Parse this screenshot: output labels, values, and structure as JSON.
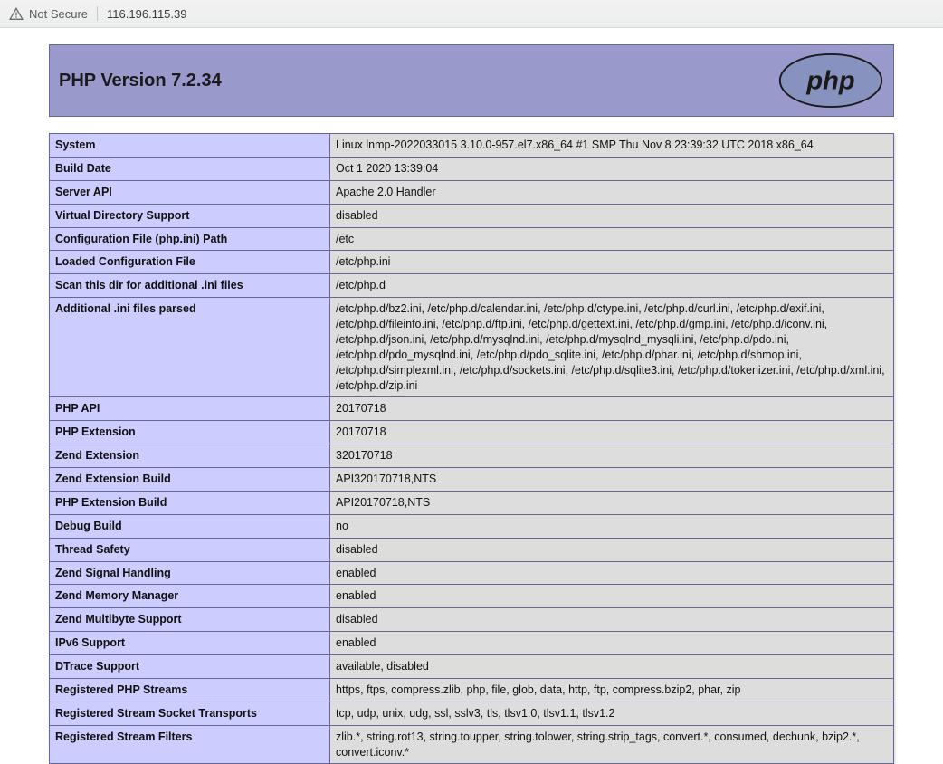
{
  "browser": {
    "security_label": "Not Secure",
    "address": "116.196.115.39"
  },
  "header": {
    "title": "PHP Version 7.2.34",
    "logo_text": "php"
  },
  "rows": [
    {
      "k": "System",
      "v": "Linux lnmp-2022033015 3.10.0-957.el7.x86_64 #1 SMP Thu Nov 8 23:39:32 UTC 2018 x86_64"
    },
    {
      "k": "Build Date",
      "v": "Oct 1 2020 13:39:04"
    },
    {
      "k": "Server API",
      "v": "Apache 2.0 Handler"
    },
    {
      "k": "Virtual Directory Support",
      "v": "disabled"
    },
    {
      "k": "Configuration File (php.ini) Path",
      "v": "/etc"
    },
    {
      "k": "Loaded Configuration File",
      "v": "/etc/php.ini"
    },
    {
      "k": "Scan this dir for additional .ini files",
      "v": "/etc/php.d"
    },
    {
      "k": "Additional .ini files parsed",
      "v": "/etc/php.d/bz2.ini, /etc/php.d/calendar.ini, /etc/php.d/ctype.ini, /etc/php.d/curl.ini, /etc/php.d/exif.ini, /etc/php.d/fileinfo.ini, /etc/php.d/ftp.ini, /etc/php.d/gettext.ini, /etc/php.d/gmp.ini, /etc/php.d/iconv.ini, /etc/php.d/json.ini, /etc/php.d/mysqlnd.ini, /etc/php.d/mysqlnd_mysqli.ini, /etc/php.d/pdo.ini, /etc/php.d/pdo_mysqlnd.ini, /etc/php.d/pdo_sqlite.ini, /etc/php.d/phar.ini, /etc/php.d/shmop.ini, /etc/php.d/simplexml.ini, /etc/php.d/sockets.ini, /etc/php.d/sqlite3.ini, /etc/php.d/tokenizer.ini, /etc/php.d/xml.ini, /etc/php.d/zip.ini"
    },
    {
      "k": "PHP API",
      "v": "20170718"
    },
    {
      "k": "PHP Extension",
      "v": "20170718"
    },
    {
      "k": "Zend Extension",
      "v": "320170718"
    },
    {
      "k": "Zend Extension Build",
      "v": "API320170718,NTS"
    },
    {
      "k": "PHP Extension Build",
      "v": "API20170718,NTS"
    },
    {
      "k": "Debug Build",
      "v": "no"
    },
    {
      "k": "Thread Safety",
      "v": "disabled"
    },
    {
      "k": "Zend Signal Handling",
      "v": "enabled"
    },
    {
      "k": "Zend Memory Manager",
      "v": "enabled"
    },
    {
      "k": "Zend Multibyte Support",
      "v": "disabled"
    },
    {
      "k": "IPv6 Support",
      "v": "enabled"
    },
    {
      "k": "DTrace Support",
      "v": "available, disabled"
    },
    {
      "k": "Registered PHP Streams",
      "v": "https, ftps, compress.zlib, php, file, glob, data, http, ftp, compress.bzip2, phar, zip"
    },
    {
      "k": "Registered Stream Socket Transports",
      "v": "tcp, udp, unix, udg, ssl, sslv3, tls, tlsv1.0, tlsv1.1, tlsv1.2"
    },
    {
      "k": "Registered Stream Filters",
      "v": "zlib.*, string.rot13, string.toupper, string.tolower, string.strip_tags, convert.*, consumed, dechunk, bzip2.*, convert.iconv.*"
    }
  ]
}
